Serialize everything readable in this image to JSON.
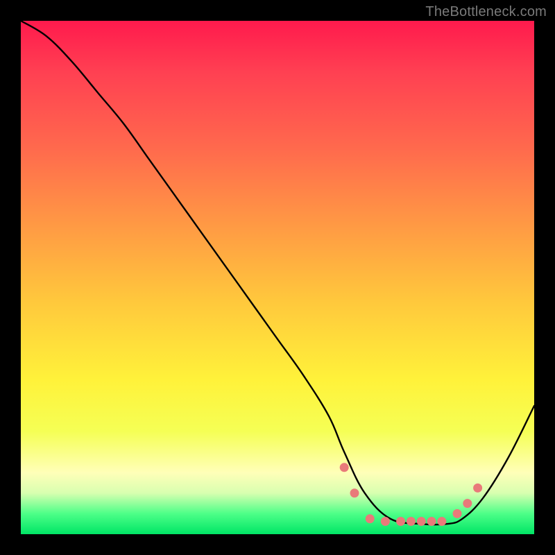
{
  "watermark": "TheBottleneck.com",
  "chart_data": {
    "type": "line",
    "title": "",
    "xlabel": "",
    "ylabel": "",
    "xlim": [
      0,
      100
    ],
    "ylim": [
      0,
      100
    ],
    "background_gradient": {
      "top": "#ff1a4d",
      "mid": "#ffe23a",
      "bottom": "#00e565"
    },
    "series": [
      {
        "name": "bottleneck-curve",
        "color": "#000000",
        "x": [
          0,
          5,
          10,
          15,
          20,
          25,
          30,
          35,
          40,
          45,
          50,
          55,
          60,
          63,
          67,
          72,
          78,
          83,
          86,
          90,
          95,
          100
        ],
        "y": [
          100,
          97,
          92,
          86,
          80,
          73,
          66,
          59,
          52,
          45,
          38,
          31,
          23,
          16,
          8,
          3,
          2,
          2,
          3,
          7,
          15,
          25
        ]
      }
    ],
    "markers": {
      "name": "highlight-dots",
      "color": "#e97a7a",
      "points": [
        {
          "x": 63,
          "y": 13
        },
        {
          "x": 65,
          "y": 8
        },
        {
          "x": 68,
          "y": 3
        },
        {
          "x": 71,
          "y": 2.5
        },
        {
          "x": 74,
          "y": 2.5
        },
        {
          "x": 76,
          "y": 2.5
        },
        {
          "x": 78,
          "y": 2.5
        },
        {
          "x": 80,
          "y": 2.5
        },
        {
          "x": 82,
          "y": 2.5
        },
        {
          "x": 85,
          "y": 4
        },
        {
          "x": 87,
          "y": 6
        },
        {
          "x": 89,
          "y": 9
        }
      ]
    }
  }
}
